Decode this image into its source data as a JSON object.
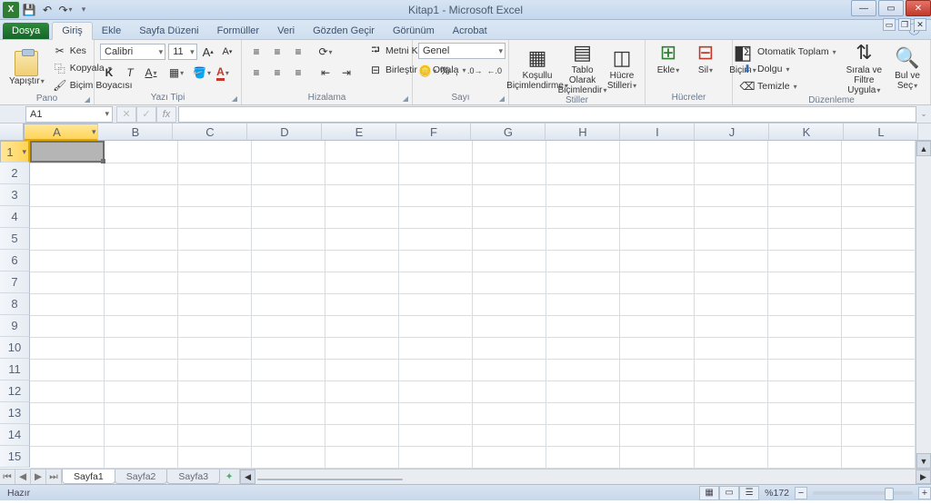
{
  "app": {
    "title": "Kitap1 - Microsoft Excel"
  },
  "qat": {
    "excel_icon": "X",
    "save_icon": "💾",
    "undo_icon": "↶",
    "redo_icon": "↷"
  },
  "tabs": {
    "file": "Dosya",
    "items": [
      "Giriş",
      "Ekle",
      "Sayfa Düzeni",
      "Formüller",
      "Veri",
      "Gözden Geçir",
      "Görünüm",
      "Acrobat"
    ],
    "active_index": 0
  },
  "ribbon": {
    "clipboard": {
      "paste": "Yapıştır",
      "cut": "Kes",
      "copy": "Kopyala",
      "format_painter": "Biçim Boyacısı",
      "title": "Pano"
    },
    "font": {
      "name": "Calibri",
      "size": "11",
      "title": "Yazı Tipi",
      "bold": "K",
      "italic": "T",
      "underline": "A"
    },
    "alignment": {
      "wrap": "Metni Kaydır",
      "merge": "Birleştir ve Ortala",
      "title": "Hizalama"
    },
    "number": {
      "format": "Genel",
      "title": "Sayı"
    },
    "styles": {
      "conditional": "Koşullu\nBiçimlendirme",
      "table": "Tablo Olarak\nBiçimlendir",
      "cell": "Hücre\nStilleri",
      "title": "Stiller"
    },
    "cells": {
      "insert": "Ekle",
      "delete": "Sil",
      "format": "Biçim",
      "title": "Hücreler"
    },
    "editing": {
      "autosum": "Otomatik Toplam",
      "fill": "Dolgu",
      "clear": "Temizle",
      "sort": "Sırala ve Filtre\nUygula",
      "find": "Bul ve\nSeç",
      "title": "Düzenleme"
    }
  },
  "namebox": "A1",
  "columns": [
    "A",
    "B",
    "C",
    "D",
    "E",
    "F",
    "G",
    "H",
    "I",
    "J",
    "K",
    "L"
  ],
  "rows": [
    "1",
    "2",
    "3",
    "4",
    "5",
    "6",
    "7",
    "8",
    "9",
    "10",
    "11",
    "12",
    "13",
    "14",
    "15"
  ],
  "sheets": [
    "Sayfa1",
    "Sayfa2",
    "Sayfa3"
  ],
  "status": {
    "ready": "Hazır",
    "zoom": "%172"
  }
}
